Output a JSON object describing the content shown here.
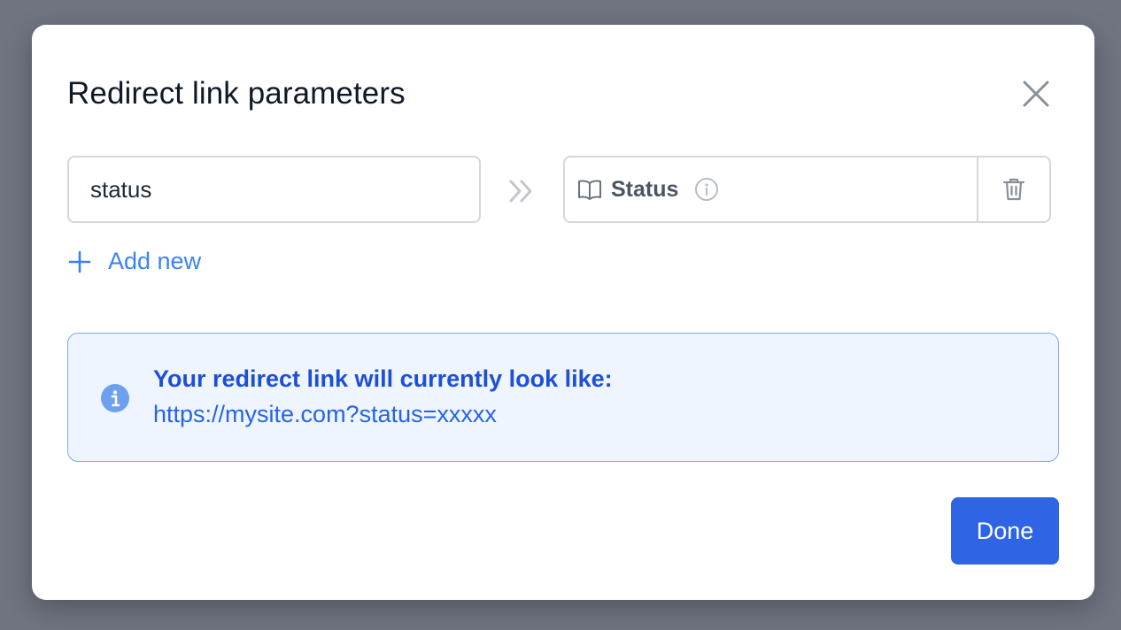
{
  "dialog": {
    "title": "Redirect link parameters",
    "close_icon": "close-icon"
  },
  "parameter": {
    "name_value": "status",
    "arrow_icon": "double-chevron-right-icon",
    "mapped_icon": "book-icon",
    "mapped_label": "Status",
    "mapped_info_icon": "info-icon",
    "delete_icon": "trash-icon"
  },
  "add_new": {
    "icon": "plus-icon",
    "label": "Add new"
  },
  "info": {
    "icon": "info-icon",
    "heading": "Your redirect link will currently look like:",
    "url": "https://mysite.com?status=xxxxx"
  },
  "footer": {
    "done_label": "Done"
  },
  "colors": {
    "accent": "#2f65e4",
    "link": "#3b82f6",
    "info_bg": "#eff5fe",
    "overlay": "#6f7480"
  }
}
